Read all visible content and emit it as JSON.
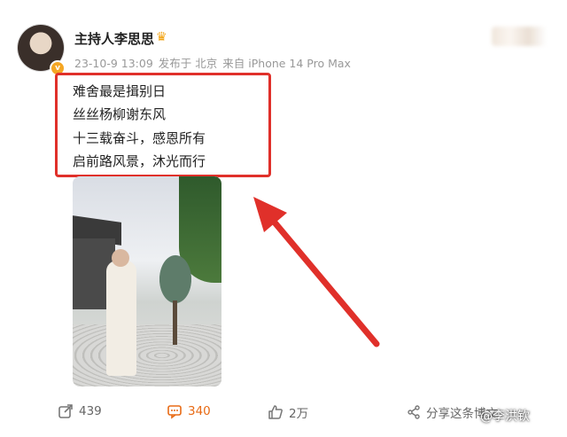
{
  "post": {
    "author": "主持人李思思",
    "date": "23-10-9 13:09",
    "location": "发布于 北京",
    "device": "来自 iPhone 14 Pro Max",
    "lines": [
      "难舍最是揖别日",
      "丝丝杨柳谢东风",
      "十三载奋斗，感恩所有",
      "启前路风景，沐光而行"
    ]
  },
  "icons": {
    "verified": "v-badge-icon",
    "crown": "crown-icon",
    "share": "share-icon",
    "comment": "comment-icon",
    "like": "like-icon",
    "share_to": "share-to-icon"
  },
  "actions": {
    "repost_count": "439",
    "comment_count": "340",
    "like_count": "2万",
    "share_label": "分享这条博文"
  },
  "watermark": "@李洪钦",
  "colors": {
    "highlight": "#e0302a",
    "comment_accent": "#e86b16",
    "badge": "#f5a623"
  }
}
